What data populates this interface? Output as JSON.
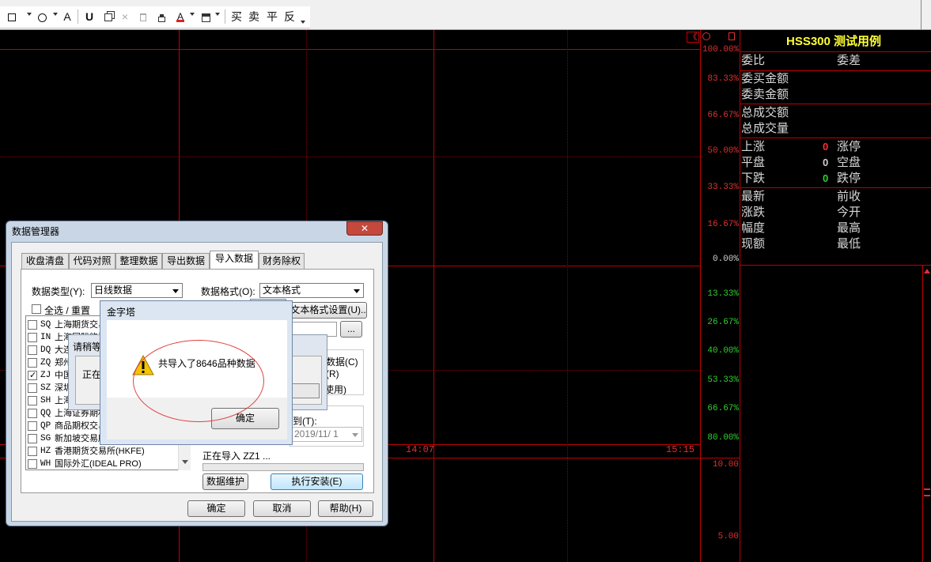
{
  "toolbar": {
    "glyph_a": "A",
    "glyph_magnet": "U",
    "glyph_delete": "×",
    "labels": [
      "买",
      "卖",
      "平",
      "反"
    ]
  },
  "chart": {
    "pct_labels": [
      {
        "text": "100.00%",
        "color": "#e03030"
      },
      {
        "text": "83.33%",
        "color": "#e03030"
      },
      {
        "text": "66.67%",
        "color": "#e03030"
      },
      {
        "text": "50.00%",
        "color": "#e03030"
      },
      {
        "text": "33.33%",
        "color": "#e03030"
      },
      {
        "text": "16.67%",
        "color": "#e03030"
      },
      {
        "text": "0.00%",
        "color": "#d0d0d0"
      },
      {
        "text": "13.33%",
        "color": "#30d030"
      },
      {
        "text": "26.67%",
        "color": "#30d030"
      },
      {
        "text": "40.00%",
        "color": "#30d030"
      },
      {
        "text": "53.33%",
        "color": "#30d030"
      },
      {
        "text": "66.67%",
        "color": "#30d030"
      },
      {
        "text": "80.00%",
        "color": "#30d030"
      }
    ],
    "time_mid": "14:07",
    "time_end": "15:15",
    "vol_top": "10.00",
    "vol_mid": "5.00",
    "collapse": "《"
  },
  "panel": {
    "title": "HSS300 测试用例",
    "r1a": "委比",
    "r1b": "委差",
    "r2": "委买金额",
    "r3": "委卖金额",
    "r4": "总成交额",
    "r5": "总成交量",
    "up": "上涨",
    "up_v": "0",
    "limit_up": "涨停",
    "flat": "平盘",
    "flat_v": "0",
    "empty": "空盘",
    "down": "下跌",
    "down_v": "0",
    "limit_down": "跌停",
    "latest": "最新",
    "prev_close": "前收",
    "change": "涨跌",
    "open": "今开",
    "range": "幅度",
    "high": "最高",
    "amount": "现额",
    "low": "最低"
  },
  "dialog": {
    "title": "数据管理器",
    "close": "✕",
    "tabs": [
      "收盘清盘",
      "代码对照",
      "整理数据",
      "导出数据",
      "导入数据",
      "财务除权"
    ],
    "data_type_label": "数据类型(Y):",
    "data_type_value": "日线数据",
    "data_format_label": "数据格式(O):",
    "data_format_value": "文本格式",
    "select_all": "全选 / 重置",
    "text_format_btn": "文本格式设置(U)..",
    "browse": "...",
    "markets": [
      {
        "code": "SQ",
        "name": "上海期货交易所",
        "checked": false
      },
      {
        "code": "IN",
        "name": "上海国际能源",
        "checked": false
      },
      {
        "code": "DQ",
        "name": "大连商品交易所",
        "checked": false
      },
      {
        "code": "ZQ",
        "name": "郑州商品交易所",
        "checked": false
      },
      {
        "code": "ZJ",
        "name": "中国金融期货",
        "checked": true
      },
      {
        "code": "SZ",
        "name": "深圳证券交易所",
        "checked": false
      },
      {
        "code": "SH",
        "name": "上海证券交易所",
        "checked": false
      },
      {
        "code": "QQ",
        "name": "上海证券期权",
        "checked": false
      },
      {
        "code": "QP",
        "name": "商品期权交易所",
        "checked": false
      },
      {
        "code": "SG",
        "name": "新加坡交易所",
        "checked": false
      },
      {
        "code": "HZ",
        "name": "香港期货交易所(HKFE)",
        "checked": false
      },
      {
        "code": "WH",
        "name": "国际外汇(IDEAL PRO)",
        "checked": false
      }
    ],
    "side_data": "数据(C)",
    "side_r": "(R)",
    "side_use": "使用)",
    "to_label": "到(T):",
    "to_value": "2019/11/ 1",
    "importing": "正在导入 ZZ1 ...",
    "maint_btn": "数据维护",
    "install_btn": "执行安装(E)",
    "ok_btn": "确定",
    "cancel_btn": "取消",
    "help_btn": "帮助(H)"
  },
  "wait": {
    "title": "请稍等",
    "text": "正在"
  },
  "msgbox": {
    "title": "金字塔",
    "close": "✕",
    "message": "共导入了8646品种数据",
    "ok": "确定"
  }
}
